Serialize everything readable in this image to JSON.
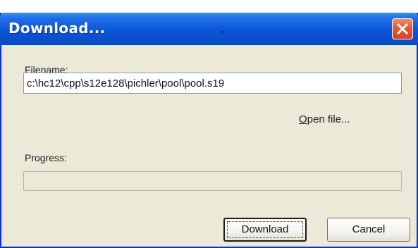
{
  "window": {
    "title": "Download..."
  },
  "icons": {
    "close": "close-icon"
  },
  "filename": {
    "label_pre": "File",
    "label_mnemonic": "n",
    "label_post": "ame:",
    "value": "c:\\hc12\\cpp\\s12e128\\pichler\\pool\\pool.s19"
  },
  "open_file": {
    "mnemonic": "O",
    "label_rest": "pen file..."
  },
  "progress": {
    "label": "Progress:",
    "percent": 0
  },
  "buttons": {
    "download": "Download",
    "cancel": "Cancel"
  },
  "colors": {
    "titlebar": "#0a55d8",
    "close_button": "#e4563a",
    "dialog_background": "#ece9d8"
  }
}
